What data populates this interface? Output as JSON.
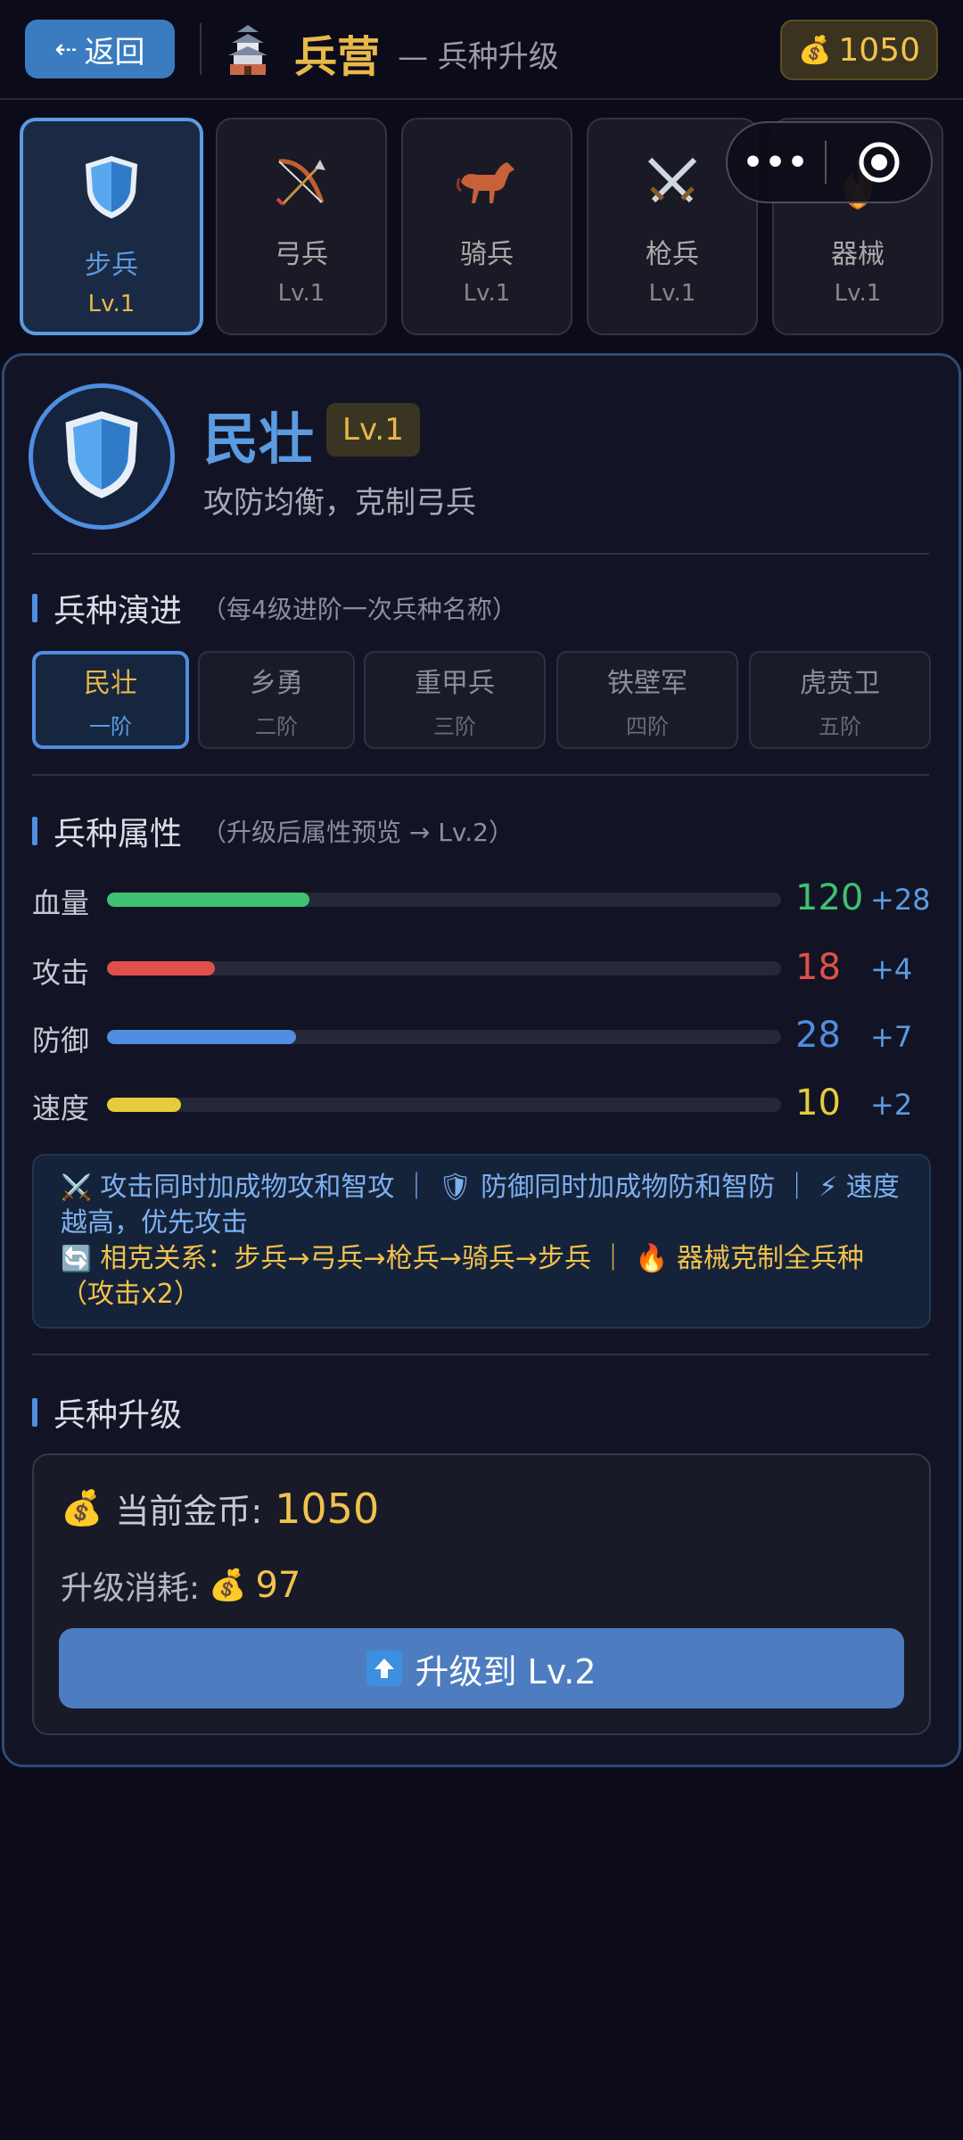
{
  "header": {
    "back_label": "返回",
    "title": "兵营",
    "subtitle": "— 兵种升级",
    "coins": "1050"
  },
  "tabs": [
    {
      "name": "步兵",
      "level": "Lv.1",
      "icon": "shield-icon",
      "active": true
    },
    {
      "name": "弓兵",
      "level": "Lv.1",
      "icon": "bow-icon"
    },
    {
      "name": "骑兵",
      "level": "Lv.1",
      "icon": "horse-icon"
    },
    {
      "name": "枪兵",
      "level": "Lv.1",
      "icon": "crossed-swords-icon"
    },
    {
      "name": "器械",
      "level": "Lv.1",
      "icon": "fire-icon"
    }
  ],
  "unit": {
    "name": "民壮",
    "level": "Lv.1",
    "desc": "攻防均衡，克制弓兵"
  },
  "evolution": {
    "title": "兵种演进",
    "note": "（每4级进阶一次兵种名称）",
    "stages": [
      {
        "name": "民壮",
        "rank": "一阶",
        "active": true
      },
      {
        "name": "乡勇",
        "rank": "二阶"
      },
      {
        "name": "重甲兵",
        "rank": "三阶"
      },
      {
        "name": "铁壁军",
        "rank": "四阶"
      },
      {
        "name": "虎贲卫",
        "rank": "五阶"
      }
    ]
  },
  "attributes": {
    "title": "兵种属性",
    "note": "（升级后属性预览 → Lv.2）",
    "stats": [
      {
        "label": "血量",
        "value": "120",
        "plus": "+28",
        "fill": 0.3,
        "color": "#3ec272"
      },
      {
        "label": "攻击",
        "value": "18",
        "plus": "+4",
        "fill": 0.16,
        "color": "#e0504a"
      },
      {
        "label": "防御",
        "value": "28",
        "plus": "+7",
        "fill": 0.28,
        "color": "#4f8ee0"
      },
      {
        "label": "速度",
        "value": "10",
        "plus": "+2",
        "fill": 0.11,
        "color": "#e6cc3a"
      }
    ],
    "info_line1": "攻击同时加成物攻和智攻 ｜ 🛡 防御同时加成物防和智防 ｜ ⚡ 速度越高，优先攻击",
    "info_line2": "相克关系：步兵→弓兵→枪兵→骑兵→步兵 ｜ 🔥 器械克制全兵种（攻击x2）"
  },
  "upgrade": {
    "title": "兵种升级",
    "current_label": "当前金币:",
    "current_value": "1050",
    "cost_label": "升级消耗:",
    "cost_value": "97",
    "button_label": "升级到 Lv.2"
  }
}
